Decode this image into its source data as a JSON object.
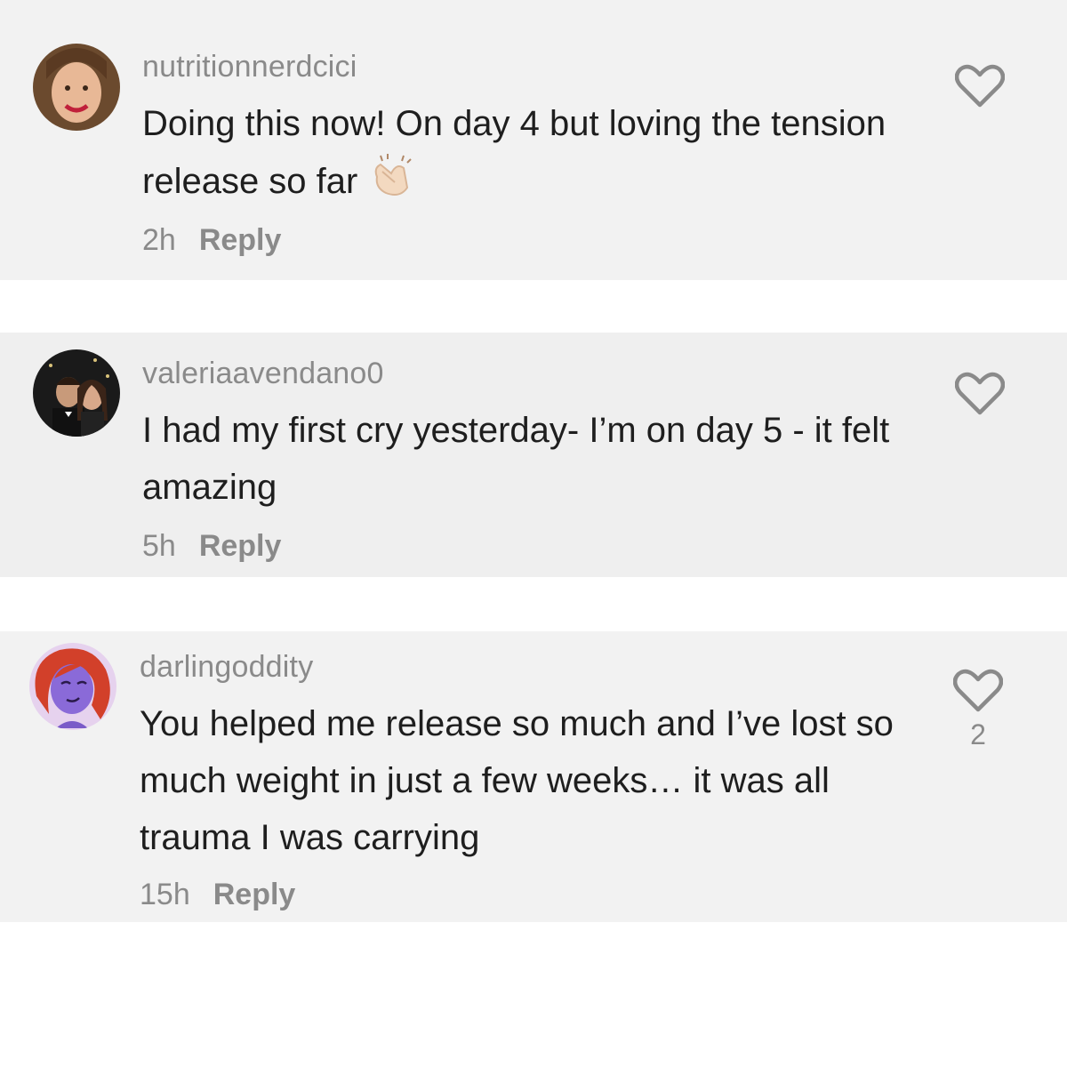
{
  "comments": [
    {
      "username": "nutritionnerdcici",
      "text": "Doing this now! On day 4 but loving the tension release so far",
      "emoji": "clapping-hands-emoji",
      "time": "2h",
      "reply_label": "Reply",
      "like_count": ""
    },
    {
      "username": "valeriaavendano0",
      "text": "I had my first cry yesterday- I’m on day 5 - it felt amazing",
      "time": "5h",
      "reply_label": "Reply",
      "like_count": ""
    },
    {
      "username": "darlingoddity",
      "text": "You helped me release so much and I’ve lost so much weight in just a few weeks… it was all trauma I was carrying",
      "time": "15h",
      "reply_label": "Reply",
      "like_count": "2"
    }
  ],
  "icons": {
    "like": "heart-outline-icon"
  },
  "colors": {
    "card_bg": "#f2f2f2",
    "text": "#1e1e1e",
    "muted": "#8a8a8a"
  }
}
